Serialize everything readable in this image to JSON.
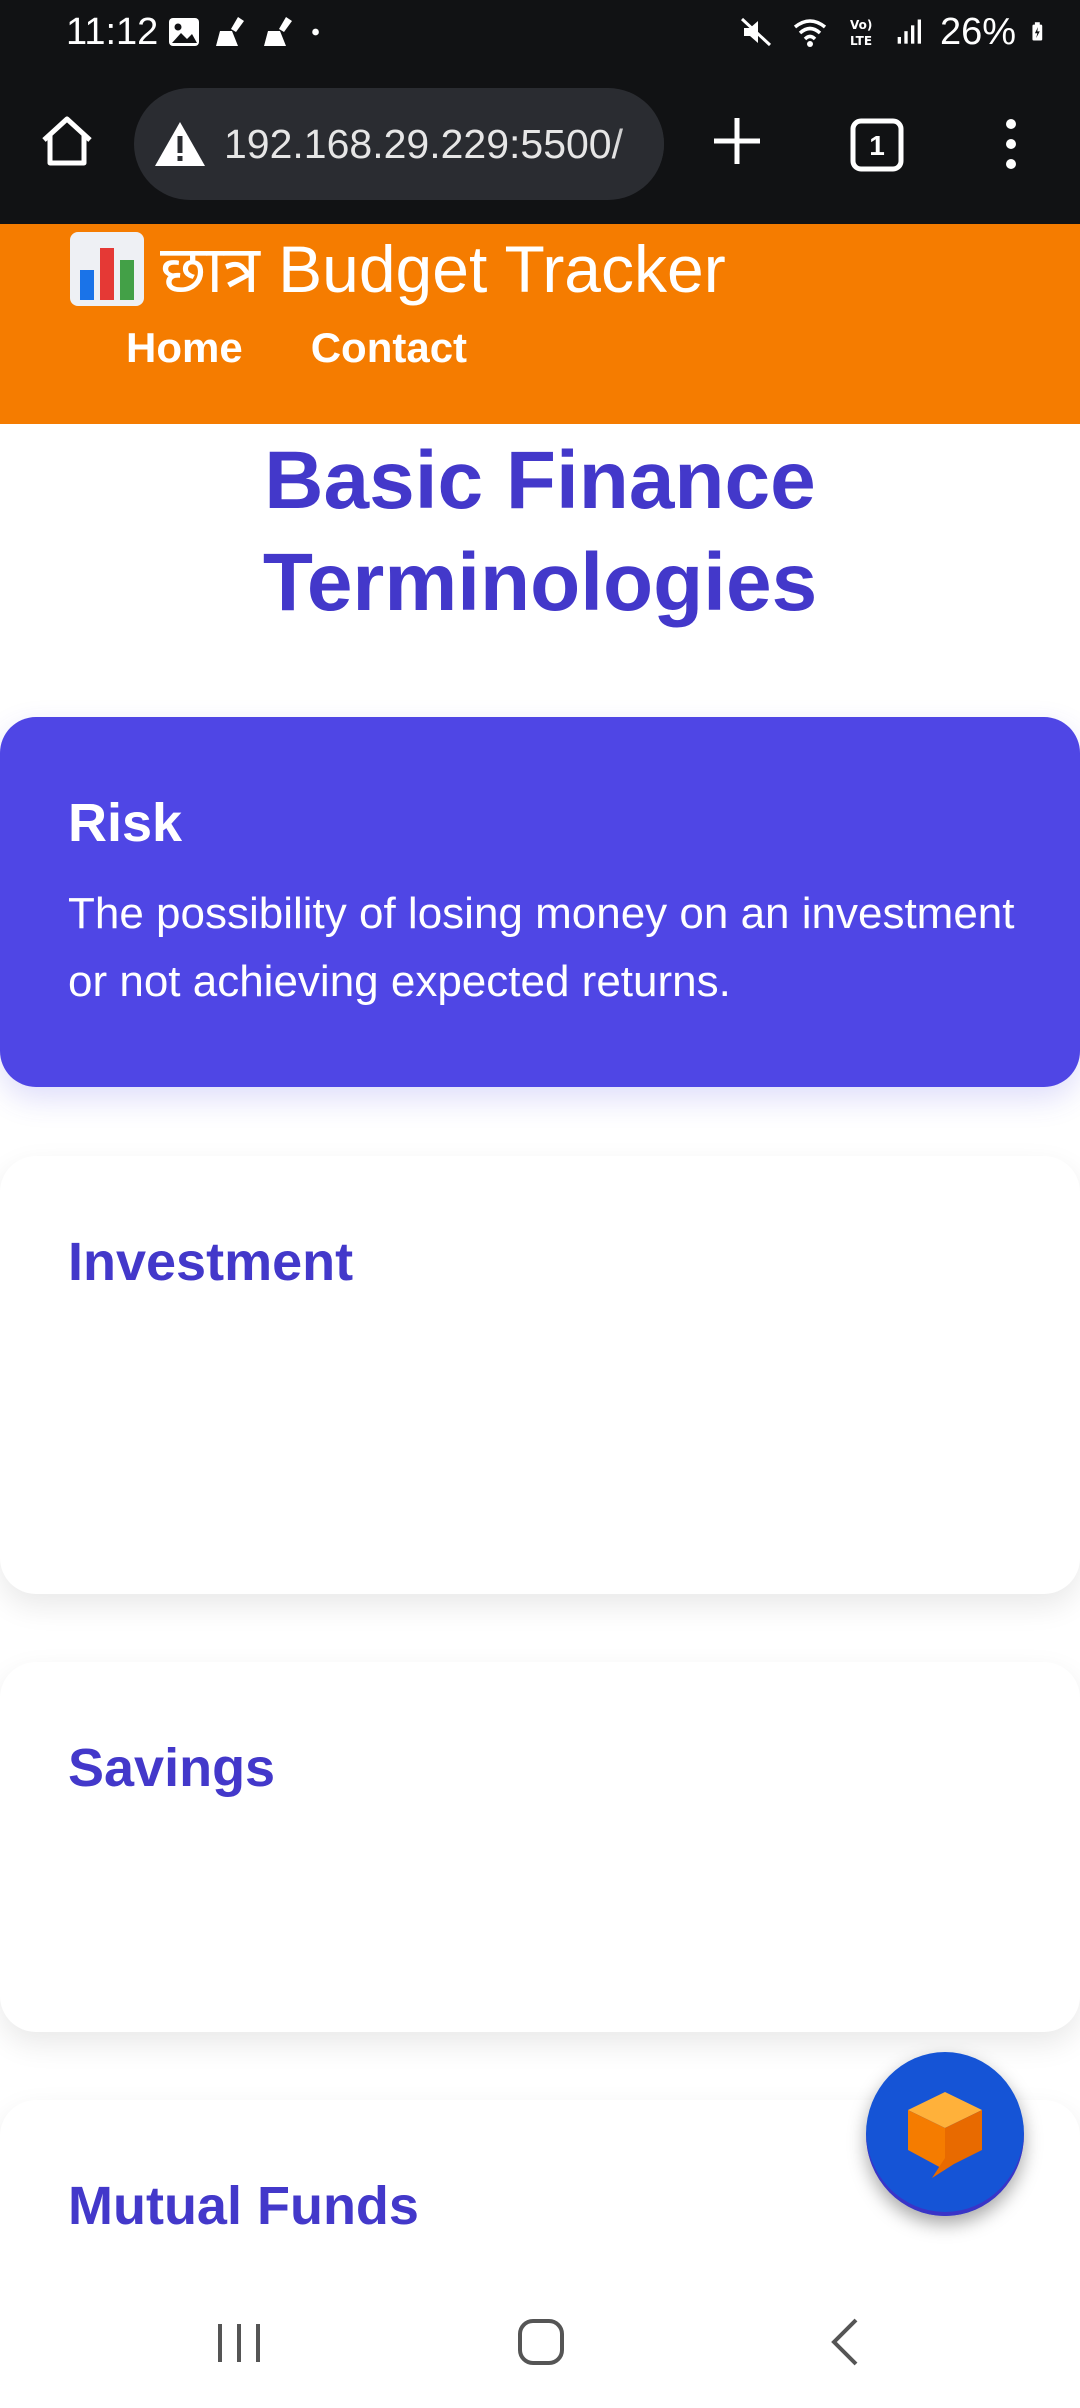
{
  "status_bar": {
    "time": "11:12",
    "battery": "26%",
    "left_icons": [
      "image-icon",
      "broom-icon",
      "broom-icon",
      "dot-icon"
    ],
    "right_icons": [
      "mute-icon",
      "wifi-icon",
      "volte-icon",
      "signal-icon",
      "battery-charging-icon"
    ]
  },
  "browser": {
    "url": "192.168.29.229:5500/",
    "tab_count": "1"
  },
  "header": {
    "brand_icon": "bar-chart-icon",
    "brand_title": "छात्र Budget Tracker",
    "nav": {
      "home": "Home",
      "contact": "Contact"
    }
  },
  "main": {
    "title_line1": "Basic Finance",
    "title_line2": "Terminologies",
    "cards": [
      {
        "title": "Risk",
        "description": "The possibility of losing money on an investment or not achieving expected returns.",
        "active": true
      },
      {
        "title": "Investment",
        "description": "",
        "active": false
      },
      {
        "title": "Savings",
        "description": "",
        "active": false
      },
      {
        "title": "Mutual Funds",
        "description": "",
        "active": false
      }
    ]
  },
  "fab": {
    "icon": "chat-cube-icon"
  },
  "colors": {
    "header_bg": "#f57c00",
    "title_text": "#4338ca",
    "active_card_bg": "#4f46e5",
    "fab_bg": "#1554d6",
    "fab_icon": "#f59a1b"
  }
}
